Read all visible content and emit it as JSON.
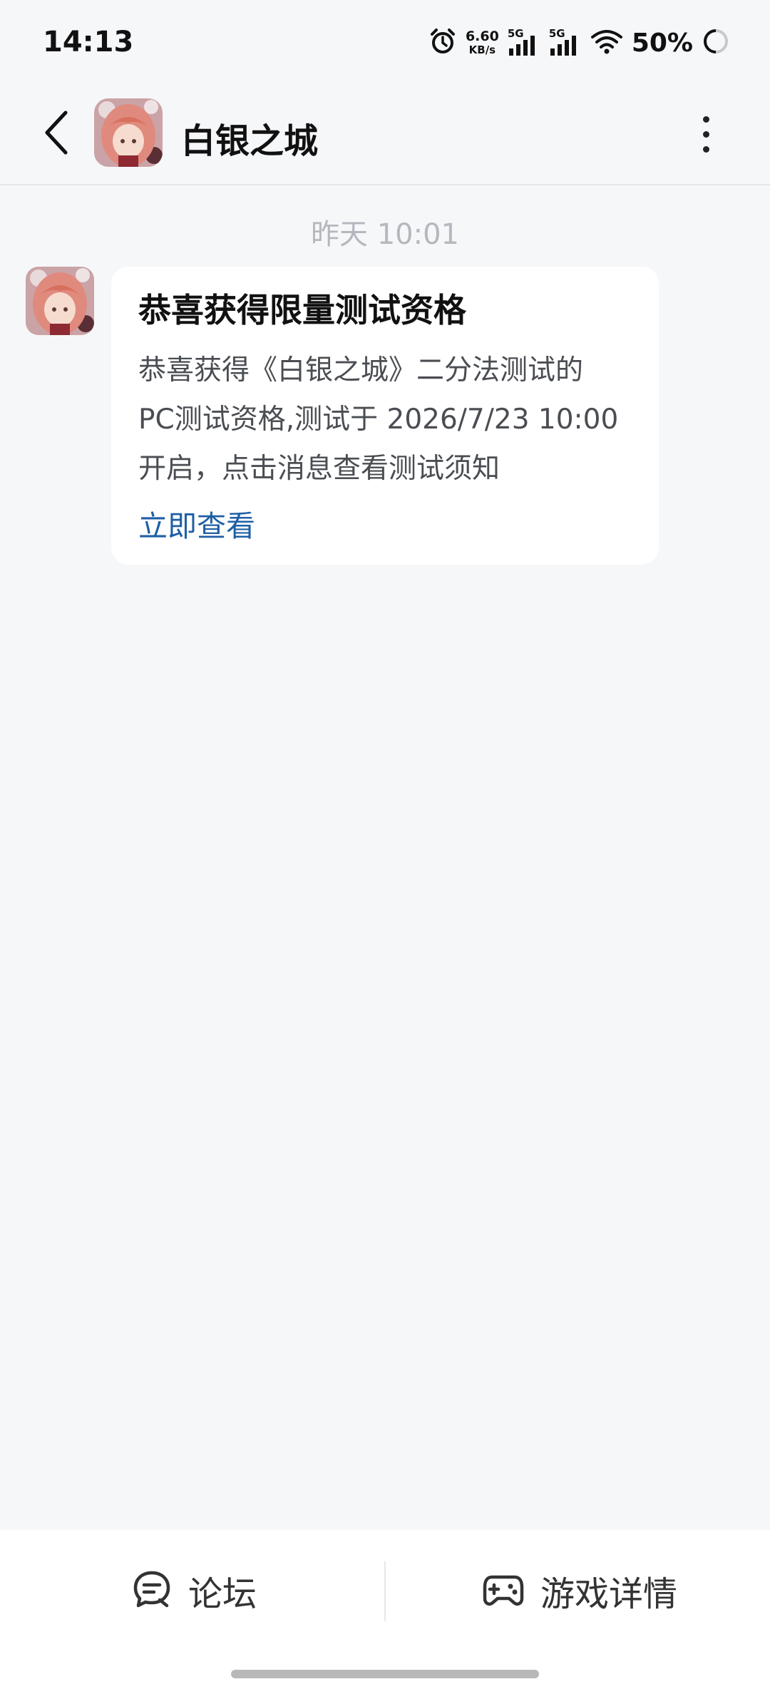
{
  "status_bar": {
    "time": "14:13",
    "net_speed_value": "6.60",
    "net_speed_unit": "KB/s",
    "signal1_label": "5G",
    "signal2_label": "5G",
    "battery": "50%"
  },
  "header": {
    "title": "白银之城"
  },
  "chat": {
    "timestamp": "昨天  10:01",
    "message": {
      "title": "恭喜获得限量测试资格",
      "body_lines": [
        "恭喜获得《白银之城》二分法测试的",
        "PC测试资格,测试于 2026/7/23 10:00",
        "开启，点击消息查看测试须知"
      ],
      "link": "立即查看"
    }
  },
  "bottom_bar": {
    "forum_label": "论坛",
    "detail_label": "游戏详情"
  },
  "colors": {
    "background": "#f6f7f9",
    "link": "#1f5fa5",
    "timestamp": "#b4b8be"
  }
}
